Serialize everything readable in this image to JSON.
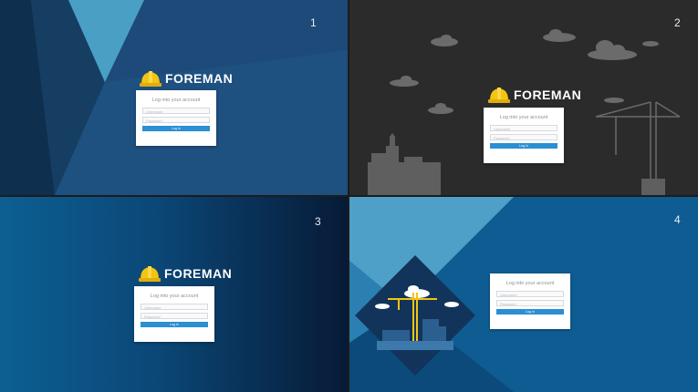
{
  "brand": {
    "name": "FOREMAN",
    "logo_icon": "hard-hat-icon",
    "logo_color": "#f3c412"
  },
  "login": {
    "title": "Log into your account",
    "username_placeholder": "Username",
    "password_placeholder": "Password",
    "button_label": "Log In"
  },
  "variants": [
    {
      "number": "1",
      "theme": "blue-geometric"
    },
    {
      "number": "2",
      "theme": "dark-construction"
    },
    {
      "number": "3",
      "theme": "blue-gradient"
    },
    {
      "number": "4",
      "theme": "blue-diamond-crane"
    }
  ],
  "colors": {
    "button": "#2a8fd3",
    "panel1": "#1d4a78",
    "panel2": "#2b2b2b",
    "panel4": "#0f5c93"
  }
}
